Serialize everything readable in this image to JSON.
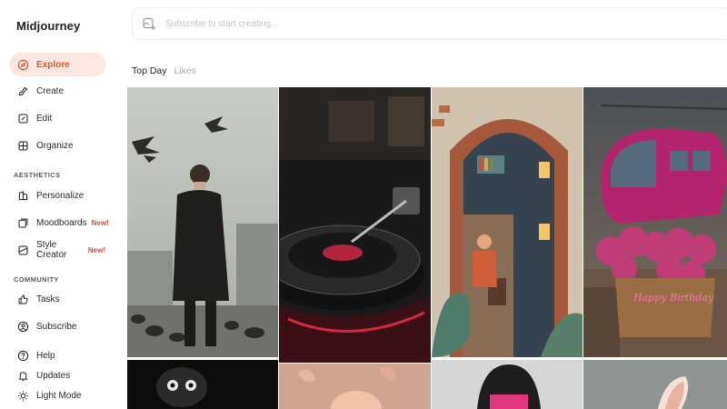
{
  "app": {
    "logo": "Midjourney"
  },
  "sidebar": {
    "items": [
      {
        "label": "Explore",
        "icon": "compass-icon",
        "active": true
      },
      {
        "label": "Create",
        "icon": "brush-icon"
      },
      {
        "label": "Edit",
        "icon": "edit-icon"
      },
      {
        "label": "Organize",
        "icon": "grid-icon"
      }
    ],
    "aesthetics_label": "AESTHETICS",
    "aesthetics_items": [
      {
        "label": "Personalize",
        "icon": "personalize-icon"
      },
      {
        "label": "Moodboards",
        "icon": "moodboard-icon",
        "badge": "New!"
      },
      {
        "label": "Style Creator",
        "icon": "style-creator-icon",
        "badge": "New!"
      }
    ],
    "community_label": "COMMUNITY",
    "community_items": [
      {
        "label": "Tasks",
        "icon": "thumbs-up-icon"
      },
      {
        "label": "Subscribe",
        "icon": "user-circle-icon"
      }
    ],
    "bottom_items": [
      {
        "label": "Help",
        "icon": "help-icon"
      },
      {
        "label": "Updates",
        "icon": "bell-icon"
      },
      {
        "label": "Light Mode",
        "icon": "sun-icon"
      }
    ]
  },
  "search": {
    "placeholder": "Subscribe to start creating...",
    "icon": "image-add-icon"
  },
  "tabs": [
    {
      "label": "Top Day",
      "active": true
    },
    {
      "label": "Likes",
      "active": false
    }
  ],
  "gallery": {
    "images": [
      {
        "name": "man-with-pigeons-image"
      },
      {
        "name": "record-player-image"
      },
      {
        "name": "paper-diorama-reader-image"
      },
      {
        "name": "pink-helicopter-birthday-image"
      },
      {
        "name": "dark-creature-image"
      },
      {
        "name": "butterflies-child-image"
      },
      {
        "name": "pink-mask-woman-image"
      },
      {
        "name": "bunny-ears-image"
      }
    ],
    "helicopter_text": "Happy Birthday"
  }
}
